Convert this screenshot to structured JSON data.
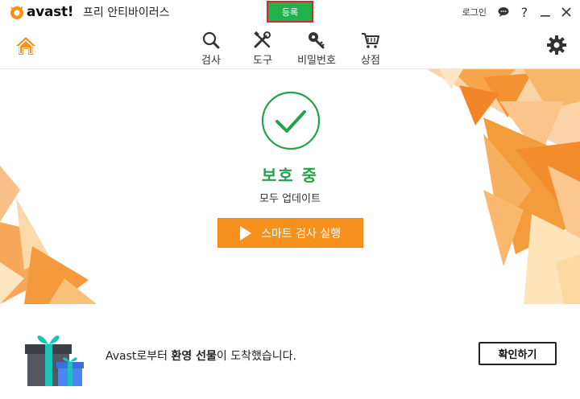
{
  "app": {
    "logo_text": "avast!",
    "product_name": "프리 안티바이러스",
    "register_label": "등록",
    "login_label": "로그인",
    "icons": [
      "help-chat-icon",
      "question-icon",
      "minimize-icon",
      "close-icon"
    ],
    "question_glyph": "?",
    "brand_color": "#f7911e",
    "register_color": "#22b24c"
  },
  "nav": {
    "items": [
      {
        "label": "검사",
        "icon": "search-icon"
      },
      {
        "label": "도구",
        "icon": "tools-icon"
      },
      {
        "label": "비밀번호",
        "icon": "key-icon"
      },
      {
        "label": "상점",
        "icon": "cart-icon"
      }
    ]
  },
  "status": {
    "title": "보호 중",
    "subtitle": "모두 업데이트",
    "color": "#22a34a",
    "scan_button": "스마트 검사 실행"
  },
  "banner": {
    "text_prefix": "Avast로부터 ",
    "text_bold": "환영 선물",
    "text_suffix": "이 도착했습니다.",
    "button": "확인하기"
  }
}
